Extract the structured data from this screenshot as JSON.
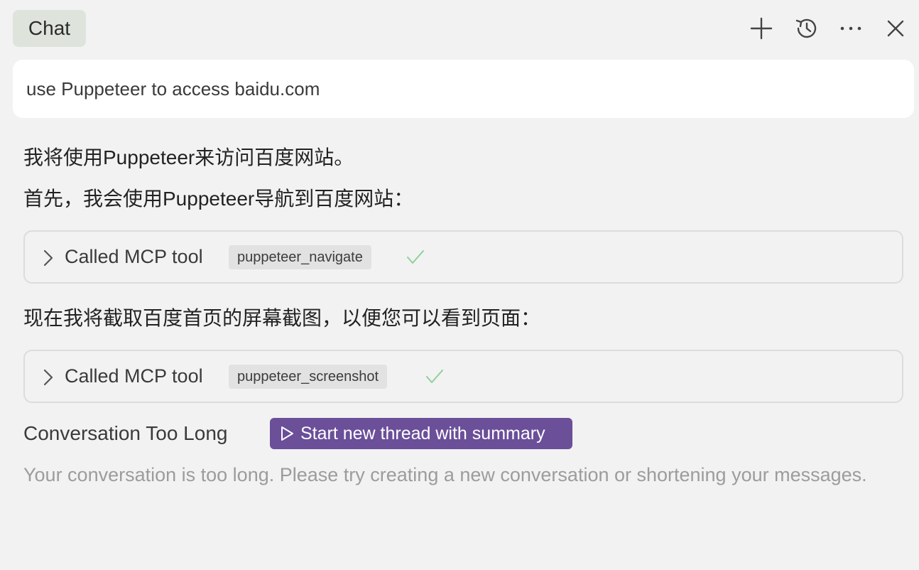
{
  "header": {
    "tab_label": "Chat",
    "icons": [
      "plus-icon",
      "history-icon",
      "more-icon",
      "close-icon"
    ]
  },
  "prompt": {
    "text": "use Puppeteer to access baidu.com"
  },
  "messages": {
    "intro": "我将使用Puppeteer来访问百度网站。",
    "step1": "首先，我会使用Puppeteer导航到百度网站：",
    "step2": "现在我将截取百度首页的屏幕截图，以便您可以看到页面："
  },
  "tool_calls": [
    {
      "label": "Called MCP tool",
      "tool": "puppeteer_navigate",
      "status": "success"
    },
    {
      "label": "Called MCP tool",
      "tool": "puppeteer_screenshot",
      "status": "success"
    }
  ],
  "error": {
    "title": "Conversation Too Long",
    "button_label": "Start new thread with summary",
    "message": "Your conversation is too long. Please try creating a new conversation or shortening your messages."
  },
  "colors": {
    "background": "#f2f2f2",
    "tab_background": "#dee4dc",
    "button_accent": "#6b4f99",
    "check_green": "#8fcf9a",
    "muted_text": "#9c9c9c"
  }
}
